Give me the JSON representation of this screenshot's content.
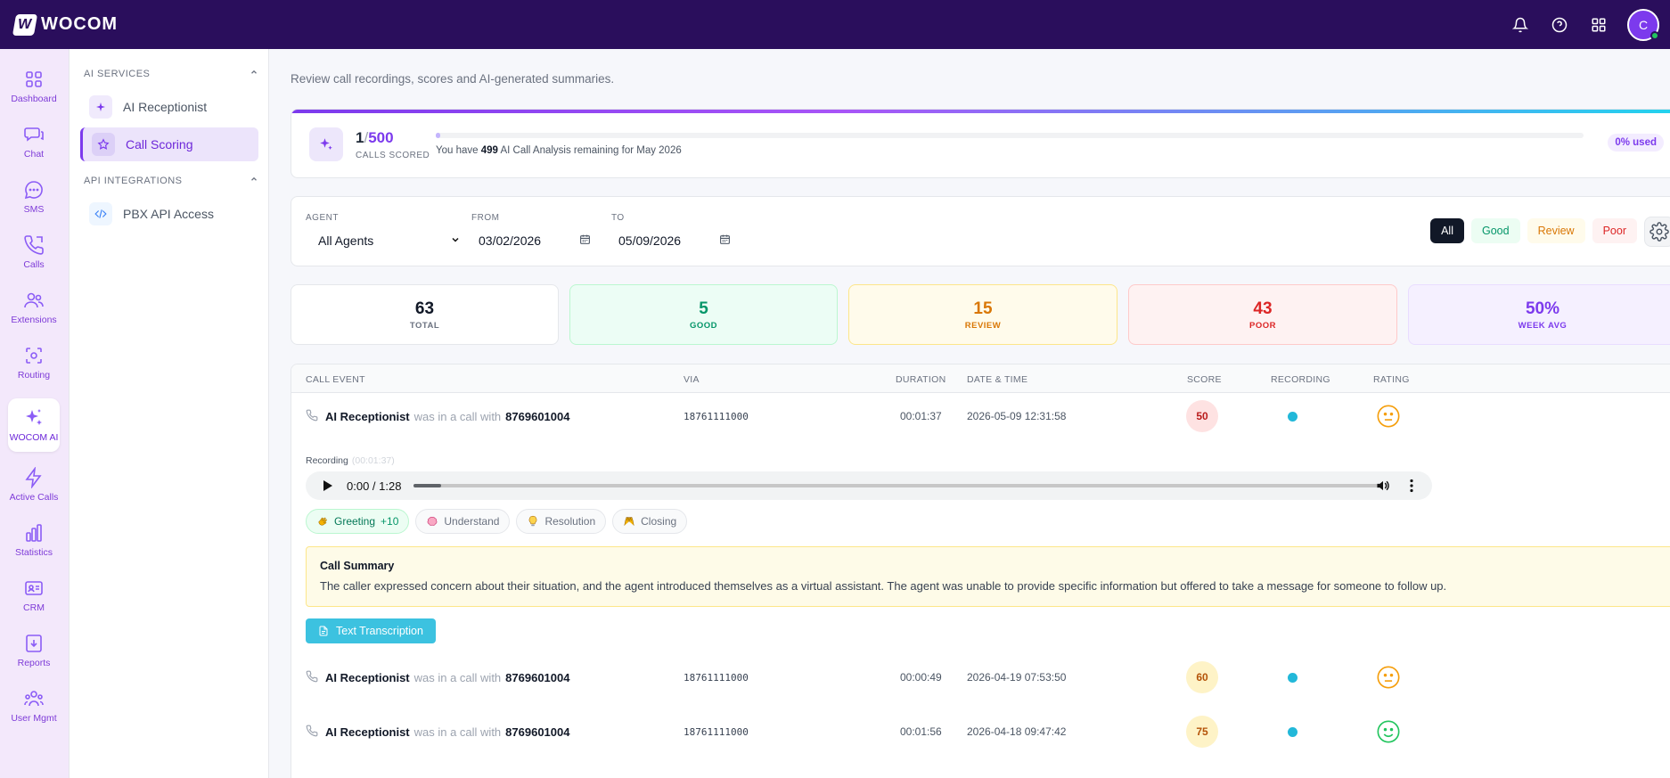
{
  "brand": {
    "name": "WOCOM"
  },
  "header": {
    "avatar_initial": "C"
  },
  "rail": [
    {
      "label": "Dashboard",
      "icon": "dashboard-icon"
    },
    {
      "label": "Chat",
      "icon": "chat-icon"
    },
    {
      "label": "SMS",
      "icon": "sms-icon"
    },
    {
      "label": "Calls",
      "icon": "calls-icon"
    },
    {
      "label": "Extensions",
      "icon": "extensions-icon"
    },
    {
      "label": "Routing",
      "icon": "routing-icon"
    },
    {
      "label": "WOCOM AI",
      "icon": "sparkles-icon"
    },
    {
      "label": "Active Calls",
      "icon": "bolt-icon"
    },
    {
      "label": "Statistics",
      "icon": "bar-chart-icon"
    },
    {
      "label": "CRM",
      "icon": "contact-card-icon"
    },
    {
      "label": "Reports",
      "icon": "download-icon"
    },
    {
      "label": "User Mgmt",
      "icon": "users-icon"
    }
  ],
  "subnav": {
    "ai_services": "AI SERVICES",
    "ai_receptionist": "AI Receptionist",
    "call_scoring": "Call Scoring",
    "api_integrations": "API INTEGRATIONS",
    "pbx_api": "PBX API Access"
  },
  "page": {
    "subtitle": "Review call recordings, scores and AI-generated summaries."
  },
  "usage": {
    "scored": "1",
    "slash": "/",
    "total": "500",
    "label": "CALLS SCORED",
    "progress": 0.002,
    "text_pre": "You have ",
    "remaining": "499",
    "text_post": " AI Call Analysis remaining for May 2026",
    "badge": "0% used"
  },
  "filters": {
    "agent_label": "AGENT",
    "agent_value": "All Agents",
    "from_label": "FROM",
    "from_value": "03/02/2026",
    "to_label": "TO",
    "to_value": "05/09/2026",
    "chips": {
      "all": "All",
      "good": "Good",
      "review": "Review",
      "poor": "Poor"
    }
  },
  "stats": {
    "total": {
      "num": "63",
      "label": "TOTAL"
    },
    "good": {
      "num": "5",
      "label": "GOOD"
    },
    "review": {
      "num": "15",
      "label": "REVIEW"
    },
    "poor": {
      "num": "43",
      "label": "POOR"
    },
    "avg": {
      "num": "50%",
      "label": "WEEK AVG"
    }
  },
  "table": {
    "headers": {
      "event": "CALL EVENT",
      "via": "VIA",
      "duration": "DURATION",
      "datetime": "DATE & TIME",
      "score": "SCORE",
      "recording": "RECORDING",
      "rating": "RATING"
    },
    "connector": "was in a call with",
    "rows": [
      {
        "agent": "AI Receptionist",
        "number": "8769601004",
        "via": "18761111000",
        "duration": "00:01:37",
        "datetime": "2026-05-09 12:31:58",
        "score": "50",
        "rating": "neutral"
      },
      {
        "agent": "AI Receptionist",
        "number": "8769601004",
        "via": "18761111000",
        "duration": "00:00:49",
        "datetime": "2026-04-19 07:53:50",
        "score": "60",
        "rating": "neutral"
      },
      {
        "agent": "AI Receptionist",
        "number": "8769601004",
        "via": "18761111000",
        "duration": "00:01:56",
        "datetime": "2026-04-18 09:47:42",
        "score": "75",
        "rating": "happy"
      }
    ],
    "expanded": {
      "recording_label": "Recording",
      "recording_duration": "(00:01:37)",
      "player_time": "0:00 / 1:28",
      "player_progress": 0.028,
      "tags": [
        {
          "label": "Greeting",
          "extra": "+10",
          "active": true,
          "icon": "clapping-hands-icon"
        },
        {
          "label": "Understand",
          "extra": "",
          "active": false,
          "icon": "brain-icon"
        },
        {
          "label": "Resolution",
          "extra": "",
          "active": false,
          "icon": "lightbulb-icon"
        },
        {
          "label": "Closing",
          "extra": "",
          "active": false,
          "icon": "raised-hands-icon"
        }
      ],
      "summary_title": "Call Summary",
      "summary_text": "The caller expressed concern about their situation, and the agent introduced themselves as a virtual assistant. The agent was unable to provide specific information but offered to take a message for someone to follow up.",
      "transcription_button": "Text Transcription"
    }
  },
  "colors": {
    "header_bg": "#2a0e5c",
    "accent": "#7c3aed",
    "good": "#059669",
    "review": "#d97706",
    "poor": "#dc2626",
    "recording": "#22b8d9"
  }
}
